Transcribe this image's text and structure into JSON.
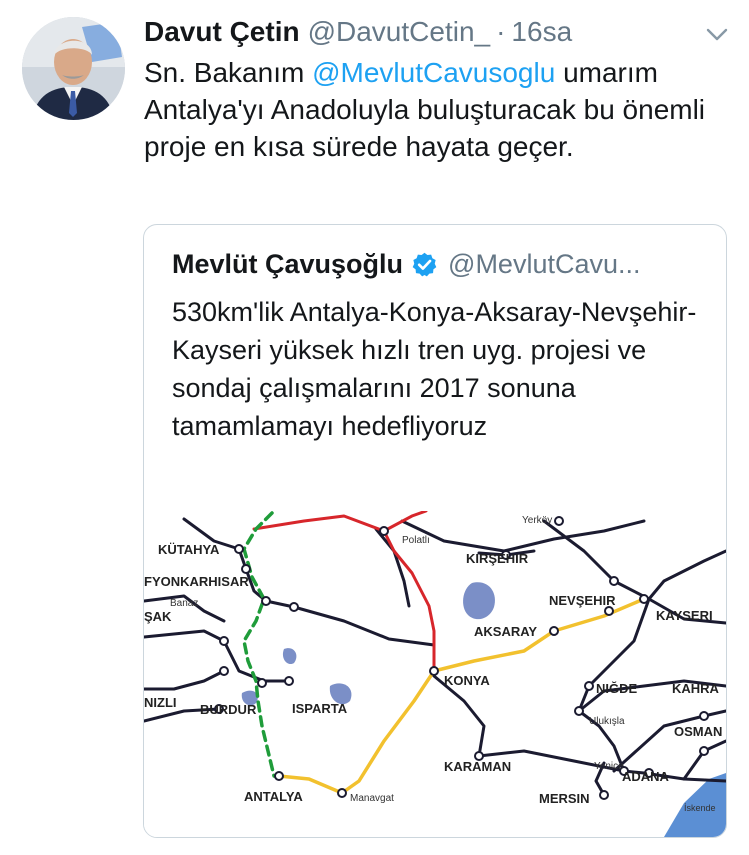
{
  "tweet": {
    "display_name": "Davut Çetin",
    "handle": "@DavutCetin_",
    "separator": "·",
    "time": "16sa",
    "text_prefix": "Sn. Bakanım ",
    "mention": "@MevlutCavusoglu",
    "text_suffix": " umarım Antalya'yı Anadoluyla buluşturacak bu önemli proje en kısa sürede hayata geçer."
  },
  "quote": {
    "display_name": "Mevlüt Çavuşoğlu",
    "handle": "@MevlutCavu...",
    "text": "530km'lik Antalya-Konya-Aksaray-Nevşehir-Kayseri yüksek hızlı tren uyg. projesi ve sondaj çalışmalarını 2017 sonuna tamamlamayı hedefliyoruz",
    "map_labels": {
      "kutahya": "KÜTAHYA",
      "afyon": "FYONKARHISAR",
      "usak": "ŞAK",
      "banaz": "Banaz",
      "denizli": "NIZLI",
      "burdur": "BURDUR",
      "isparta": "ISPARTA",
      "antalya": "ANTALYA",
      "manavgat": "Manavgat",
      "polatli": "Polatlı",
      "kirsehir": "KIRŞEHIR",
      "yerkoy": "Yerköy",
      "nevsehir": "NEVŞEHIR",
      "kayseri": "KAYSERI",
      "aksaray": "AKSARAY",
      "konya": "KONYA",
      "nigde": "NIĞDE",
      "kahra": "KAHRA",
      "ulukisla": "Ulukışla",
      "osman": "OSMAN",
      "karaman": "KARAMAN",
      "yenice": "Yenice",
      "adana": "ADANA",
      "mersin": "MERSIN",
      "iskende": "İskende"
    }
  },
  "colors": {
    "mention": "#1da1f2",
    "muted": "#657786",
    "verified": "#1da1f2",
    "route_new": "#f2c12e",
    "route_hsr": "#d7262b",
    "route_planned": "#1f9c3a",
    "rail": "#1b1b30",
    "lake": "#7b8fc7",
    "sea": "#5b8fd4"
  }
}
